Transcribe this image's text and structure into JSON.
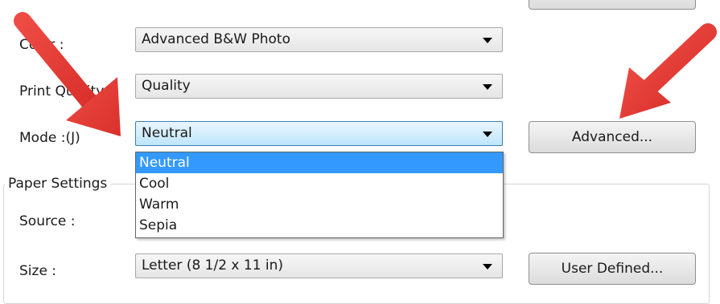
{
  "settings": {
    "color_label": "Color :",
    "color_value": "Advanced B&W Photo",
    "quality_label": "Print Quality :",
    "quality_value": "Quality",
    "mode_label": "Mode :(J)",
    "mode_value": "Neutral",
    "advanced_button": "Advanced...",
    "mode_options": [
      "Neutral",
      "Cool",
      "Warm",
      "Sepia"
    ]
  },
  "paper": {
    "group_title": "Paper Settings",
    "source_label": "Source :",
    "size_label": "Size :",
    "size_value": "Letter (8 1/2 x 11 in)",
    "user_defined_button": "User Defined..."
  },
  "colors": {
    "accent": "#3399ff",
    "annotation_arrow": "#e53935"
  }
}
